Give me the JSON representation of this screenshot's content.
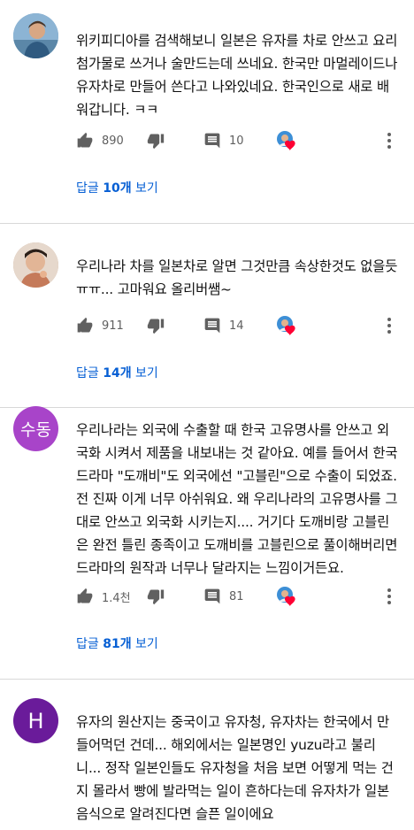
{
  "comments": [
    {
      "avatar": {
        "type": "photo",
        "bg": "#7aa7c9"
      },
      "text": "위키피디아를 검색해보니 일본은 유자를 차로 안쓰고 요리첨가물로 쓰거나 술만드는데 쓰네요. 한국만 마멀레이드나 유자차로 만들어 쓴다고 나와있네요. 한국인으로 새로 배워갑니다. ㅋㅋ",
      "likes": "890",
      "replies_count": "10",
      "replies_prefix": "답글 ",
      "replies_suffix": " 보기",
      "replies_num": "10개"
    },
    {
      "avatar": {
        "type": "photo",
        "bg": "#c9a58a"
      },
      "text": "우리나라 차를 일본차로 알면 그것만큼 속상한것도 없을듯 ㅠㅠ... 고마워요 올리버쌤~",
      "likes": "911",
      "replies_count": "14",
      "replies_prefix": "답글 ",
      "replies_suffix": " 보기",
      "replies_num": "14개"
    },
    {
      "avatar": {
        "type": "initials",
        "label": "수동",
        "bg": "#a844c9"
      },
      "text": "우리나라는 외국에 수출할 때 한국 고유명사를 안쓰고 외국화 시켜서 제품을 내보내는 것 같아요. 예를 들어서 한국 드라마 \"도깨비\"도 외국에선 \"고블린\"으로 수출이 되었죠. 전 진짜 이게 너무 아쉬워요. 왜 우리나라의 고유명사를 그대로 안쓰고 외국화 시키는지.... 거기다 도깨비랑 고블린은 완전 틀린 종족이고 도깨비를 고블린으로 풀이해버리면 드라마의 원작과 너무나 달라지는 느낌이거든요.",
      "likes": "1.4천",
      "replies_count": "81",
      "replies_prefix": "답글 ",
      "replies_suffix": " 보기",
      "replies_num": "81개"
    },
    {
      "avatar": {
        "type": "initials",
        "label": "H",
        "bg": "#6a1b9a"
      },
      "text": "유자의 원산지는 중국이고 유자청, 유자차는 한국에서 만들어먹던 건데... 해외에서는 일본명인 yuzu라고 불리니... 정작 일본인들도 유자청을 처음 보면 어떻게 먹는 건지 몰라서 빵에 발라먹는 일이 흔하다는데 유자차가 일본음식으로 알려진다면 슬픈 일이에요"
    }
  ],
  "colors": {
    "accent": "#065fd4",
    "heart": "#ff0033"
  }
}
